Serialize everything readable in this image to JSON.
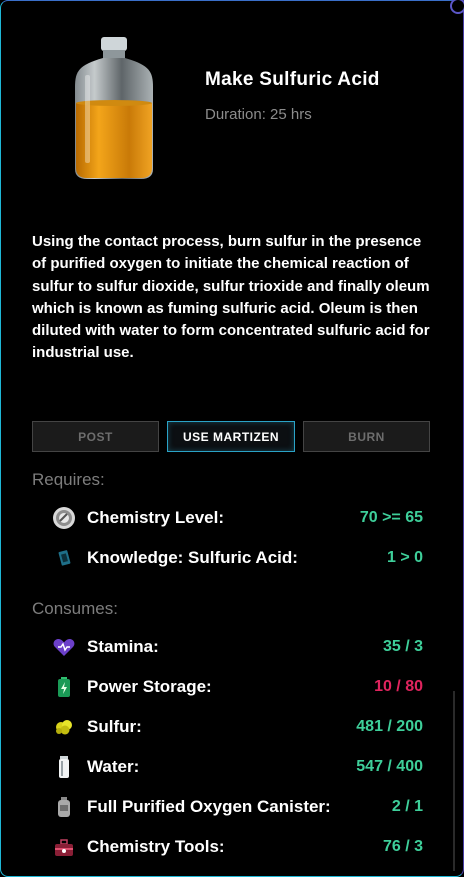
{
  "recipe": {
    "title": "Make Sulfuric Acid",
    "duration": "Duration: 25 hrs",
    "description": "Using the contact process, burn sulfur in the presence of purified oxygen to initiate the chemical reaction of sulfur to sulfur dioxide, sulfur trioxide and finally oleum which is known as fuming sulfuric acid. Oleum is then diluted with water to form concentrated sulfuric acid for industrial use."
  },
  "actions": {
    "post": "POST",
    "use_martizen": "USE MARTIZEN",
    "burn": "BURN"
  },
  "requires": {
    "label": "Requires:",
    "items": [
      {
        "label": "Chemistry Level:",
        "value": "70 >= 65",
        "icon": "chemistry-level-icon",
        "status": "ok"
      },
      {
        "label": "Knowledge: Sulfuric Acid:",
        "value": "1 > 0",
        "icon": "knowledge-card-icon",
        "status": "ok"
      }
    ]
  },
  "consumes": {
    "label": "Consumes:",
    "items": [
      {
        "label": "Stamina:",
        "value": "35 / 3",
        "icon": "heart-icon",
        "status": "ok"
      },
      {
        "label": "Power Storage:",
        "value": "10 / 80",
        "icon": "battery-icon",
        "status": "insufficient"
      },
      {
        "label": "Sulfur:",
        "value": "481 / 200",
        "icon": "sulfur-icon",
        "status": "ok"
      },
      {
        "label": "Water:",
        "value": "547 / 400",
        "icon": "water-icon",
        "status": "ok"
      },
      {
        "label": "Full Purified Oxygen Canister:",
        "value": "2 / 1",
        "icon": "oxygen-canister-icon",
        "status": "ok"
      },
      {
        "label": "Chemistry Tools:",
        "value": "76 / 3",
        "icon": "toolbox-icon",
        "status": "ok"
      }
    ]
  },
  "colors": {
    "ok": "#3ecf9a",
    "insufficient": "#e0245e",
    "accent": "#2aa3c7"
  }
}
